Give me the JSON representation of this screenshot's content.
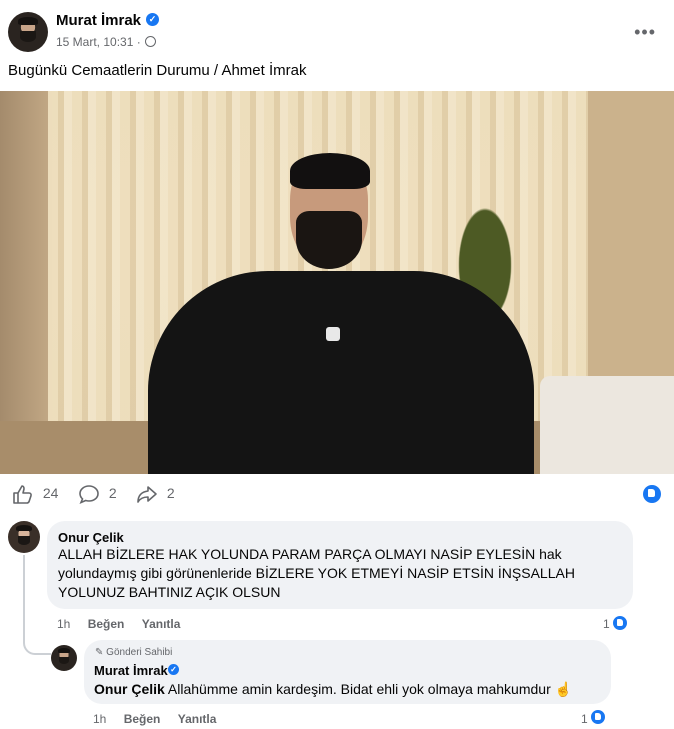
{
  "post": {
    "author": "Murat İmrak",
    "date": "15 Mart, 10:31",
    "dot": "·",
    "more": "•••",
    "text": "Bugünkü Cemaatlerin Durumu / Ahmet İmrak",
    "verified_mark": "✓"
  },
  "reactions": {
    "likes": "24",
    "comments": "2",
    "shares": "2"
  },
  "icons": {
    "like": "👍",
    "comment": "💬",
    "share": "↪"
  },
  "comments": [
    {
      "name": "Onur Çelik",
      "text": "ALLAH BİZLERE HAK YOLUNDA PARAM PARÇA OLMAYI NASİP EYLESİN hak yolundaymış gibi görünenleride BİZLERE YOK ETMEYİ NASİP ETSİN İNŞSALLAH YOLUNUZ BAHTINIZ AÇIK OLSUN",
      "time": "1h",
      "like_label": "Beğen",
      "reply_label": "Yanıtla",
      "like_count": "1"
    }
  ],
  "reply": {
    "badge": "Gönderi Sahibi",
    "name": "Murat İmrak",
    "mention": "Onur Çelik",
    "text": " Allahümme amin kardeşim. Bidat ehli yok olmaya mahkumdur ☝",
    "time": "1h",
    "like_label": "Beğen",
    "reply_label": "Yanıtla",
    "like_count": "1"
  },
  "colors": {
    "accent": "#1877f2",
    "secondary_text": "#65676b",
    "bubble": "#f0f2f5"
  }
}
